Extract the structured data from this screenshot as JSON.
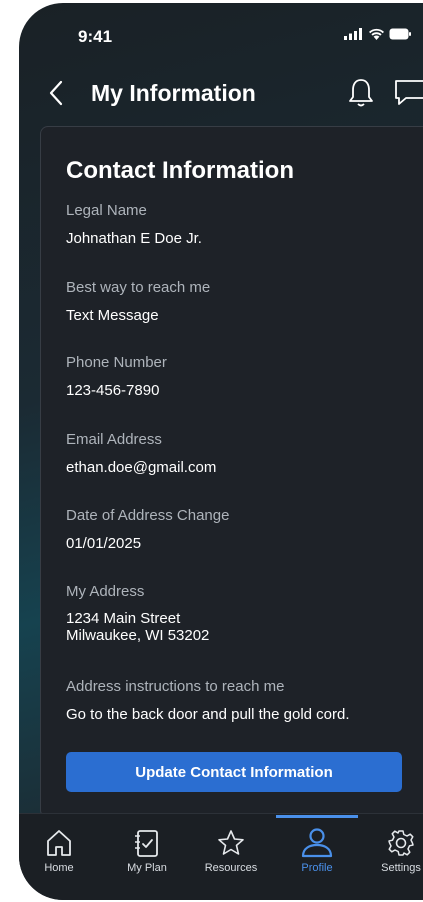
{
  "status": {
    "time": "9:41"
  },
  "header": {
    "title": "My Information"
  },
  "card": {
    "title": "Contact Information",
    "fields": [
      {
        "label": "Legal Name",
        "value": "Johnathan E Doe Jr."
      },
      {
        "label": "Best way to reach me",
        "value": "Text Message"
      },
      {
        "label": "Phone Number",
        "value": "123-456-7890"
      },
      {
        "label": "Email Address",
        "value": "ethan.doe@gmail.com"
      },
      {
        "label": "Date of Address Change",
        "value": "01/01/2025"
      }
    ],
    "address": {
      "label": "My Address",
      "line1": "1234 Main Street",
      "line2": "Milwaukee, WI 53202"
    },
    "instructions": {
      "label": "Address instructions to reach me",
      "value": "Go to the back door and pull the gold cord."
    },
    "button_label": "Update Contact Information"
  },
  "tabs": [
    {
      "label": "Home",
      "icon": "home-icon"
    },
    {
      "label": "My Plan",
      "icon": "checklist-icon"
    },
    {
      "label": "Resources",
      "icon": "star-icon"
    },
    {
      "label": "Profile",
      "icon": "person-icon",
      "active": true
    },
    {
      "label": "Settings",
      "icon": "gear-icon"
    }
  ],
  "colors": {
    "accent": "#4a90ea",
    "button": "#2b6ed1",
    "card": "#1e2228"
  }
}
